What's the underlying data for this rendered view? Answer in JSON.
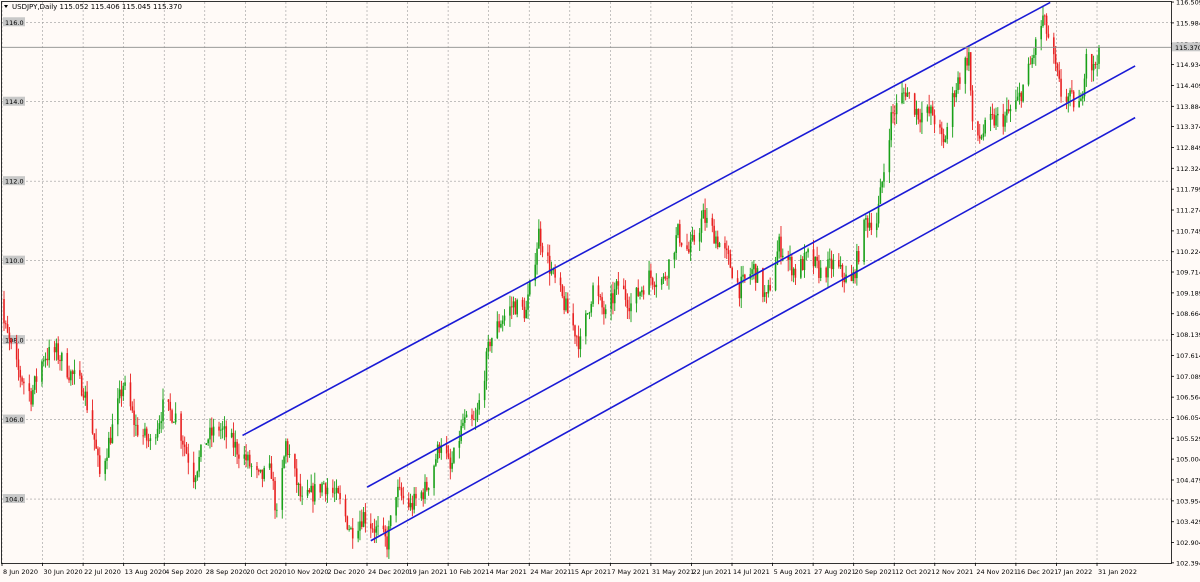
{
  "symbol_header": "USDJPY,Daily  115.052 115.406 115.045 115.370",
  "current_price_label": "115.370",
  "price_labels": [
    "116.509",
    "115.984",
    "115.459",
    "114.934",
    "114.409",
    "113.884",
    "113.374",
    "112.849",
    "112.324",
    "111.799",
    "111.274",
    "110.749",
    "110.224",
    "109.714",
    "109.189",
    "108.664",
    "108.139",
    "107.614",
    "107.089",
    "106.564",
    "106.054",
    "105.529",
    "105.004",
    "104.479",
    "103.954",
    "103.429",
    "102.904",
    "102.394"
  ],
  "highlight_price_labels": [
    {
      "text": "116.0",
      "price": 116.0
    },
    {
      "text": "114.0",
      "price": 114.0
    },
    {
      "text": "112.0",
      "price": 112.0
    },
    {
      "text": "110.0",
      "price": 110.0
    },
    {
      "text": "108.0",
      "price": 108.0
    },
    {
      "text": "106.0",
      "price": 106.0
    },
    {
      "text": "104.0",
      "price": 104.0
    }
  ],
  "date_labels": [
    "8 Jun 2020",
    "30 Jun 2020",
    "22 Jul 2020",
    "13 Aug 2020",
    "4 Sep 2020",
    "28 Sep 2020",
    "20 Oct 2020",
    "10 Nov 2020",
    "2 Dec 2020",
    "24 Dec 2020",
    "19 Jan 2021",
    "10 Feb 2021",
    "4 Mar 2021",
    "24 Mar 2021",
    "15 Apr 2021",
    "7 May 2021",
    "31 May 2021",
    "22 Jun 2021",
    "14 Jul 2021",
    "5 Aug 2021",
    "27 Aug 2021",
    "20 Sep 2021",
    "12 Oct 2021",
    "2 Nov 2021",
    "24 Nov 2021",
    "16 Dec 2021",
    "7 Jan 2022",
    "31 Jan 2022"
  ],
  "colors": {
    "bull": "#18a018",
    "bear": "#e82020",
    "trendline": "#1a1ad6",
    "background": "#fffaf7",
    "grid": "#9c9c9c"
  },
  "chart_data": {
    "type": "candlestick",
    "symbol": "USDJPY",
    "timeframe": "Daily",
    "last_bar": {
      "open": 115.052,
      "high": 115.406,
      "low": 115.045,
      "close": 115.37
    },
    "ylim": [
      102.39,
      116.51
    ],
    "xlim": [
      "2020-06-08",
      "2022-02-04"
    ],
    "grid": true,
    "price_path": [
      [
        "2020-06-03",
        109.6
      ],
      [
        "2020-06-08",
        108.4
      ],
      [
        "2020-06-15",
        107.3
      ],
      [
        "2020-06-23",
        106.6
      ],
      [
        "2020-06-30",
        107.6
      ],
      [
        "2020-07-07",
        107.7
      ],
      [
        "2020-07-14",
        107.2
      ],
      [
        "2020-07-22",
        106.8
      ],
      [
        "2020-07-28",
        105.5
      ],
      [
        "2020-07-31",
        104.6
      ],
      [
        "2020-08-06",
        105.6
      ],
      [
        "2020-08-13",
        106.9
      ],
      [
        "2020-08-20",
        105.8
      ],
      [
        "2020-08-28",
        105.4
      ],
      [
        "2020-09-04",
        106.3
      ],
      [
        "2020-09-11",
        106.1
      ],
      [
        "2020-09-21",
        104.6
      ],
      [
        "2020-09-28",
        105.5
      ],
      [
        "2020-10-05",
        105.8
      ],
      [
        "2020-10-20",
        105.0
      ],
      [
        "2020-10-27",
        104.5
      ],
      [
        "2020-11-03",
        104.7
      ],
      [
        "2020-11-06",
        103.5
      ],
      [
        "2020-11-11",
        105.4
      ],
      [
        "2020-11-20",
        103.9
      ],
      [
        "2020-12-02",
        104.4
      ],
      [
        "2020-12-10",
        104.0
      ],
      [
        "2020-12-17",
        103.2
      ],
      [
        "2020-12-24",
        103.6
      ],
      [
        "2021-01-06",
        102.9
      ],
      [
        "2021-01-11",
        104.2
      ],
      [
        "2021-01-19",
        103.8
      ],
      [
        "2021-01-28",
        104.3
      ],
      [
        "2021-02-05",
        105.5
      ],
      [
        "2021-02-10",
        104.7
      ],
      [
        "2021-02-17",
        105.9
      ],
      [
        "2021-02-24",
        105.9
      ],
      [
        "2021-03-04",
        108.0
      ],
      [
        "2021-03-10",
        108.5
      ],
      [
        "2021-03-17",
        108.9
      ],
      [
        "2021-03-24",
        108.7
      ],
      [
        "2021-03-31",
        110.7
      ],
      [
        "2021-04-07",
        109.7
      ],
      [
        "2021-04-15",
        108.8
      ],
      [
        "2021-04-23",
        107.9
      ],
      [
        "2021-04-30",
        109.3
      ],
      [
        "2021-05-07",
        108.6
      ],
      [
        "2021-05-14",
        109.4
      ],
      [
        "2021-05-21",
        108.9
      ],
      [
        "2021-05-31",
        109.6
      ],
      [
        "2021-06-08",
        109.5
      ],
      [
        "2021-06-16",
        110.7
      ],
      [
        "2021-06-22",
        110.2
      ],
      [
        "2021-06-30",
        111.1
      ],
      [
        "2021-07-07",
        110.6
      ],
      [
        "2021-07-14",
        110.0
      ],
      [
        "2021-07-20",
        109.3
      ],
      [
        "2021-07-28",
        109.8
      ],
      [
        "2021-08-04",
        109.0
      ],
      [
        "2021-08-11",
        110.4
      ],
      [
        "2021-08-20",
        109.7
      ],
      [
        "2021-08-27",
        110.1
      ],
      [
        "2021-09-03",
        109.7
      ],
      [
        "2021-09-10",
        109.9
      ],
      [
        "2021-09-20",
        109.4
      ],
      [
        "2021-09-28",
        111.0
      ],
      [
        "2021-10-04",
        111.0
      ],
      [
        "2021-10-12",
        113.6
      ],
      [
        "2021-10-20",
        114.3
      ],
      [
        "2021-10-27",
        113.7
      ],
      [
        "2021-11-04",
        113.7
      ],
      [
        "2021-11-10",
        112.9
      ],
      [
        "2021-11-16",
        114.3
      ],
      [
        "2021-11-24",
        115.2
      ],
      [
        "2021-11-26",
        113.3
      ],
      [
        "2021-11-30",
        113.1
      ],
      [
        "2021-12-06",
        113.5
      ],
      [
        "2021-12-14",
        113.6
      ],
      [
        "2021-12-21",
        114.0
      ],
      [
        "2021-12-28",
        114.9
      ],
      [
        "2022-01-04",
        116.1
      ],
      [
        "2022-01-07",
        115.6
      ],
      [
        "2022-01-14",
        114.2
      ],
      [
        "2022-01-21",
        114.0
      ],
      [
        "2022-01-25",
        113.9
      ],
      [
        "2022-01-28",
        115.3
      ],
      [
        "2022-02-01",
        114.8
      ],
      [
        "2022-02-04",
        115.37
      ]
    ],
    "trendlines": [
      {
        "from": [
          "2020-10-18",
          105.6
        ],
        "to": [
          "2022-01-08",
          116.5
        ]
      },
      {
        "from": [
          "2020-12-26",
          104.3
        ],
        "to": [
          "2022-02-24",
          114.9
        ]
      },
      {
        "from": [
          "2020-12-28",
          102.95
        ],
        "to": [
          "2022-02-24",
          113.6
        ]
      }
    ]
  }
}
